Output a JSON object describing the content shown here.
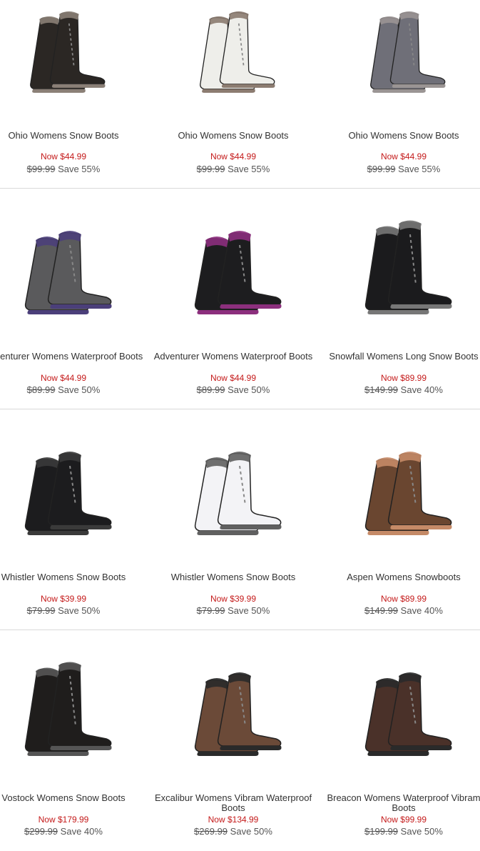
{
  "products": [
    {
      "name": "Ohio Womens Snow Boots",
      "now": "Now $44.99",
      "was": "$99.99",
      "save": "Save 55%",
      "icon": "snow-boot-black-icon",
      "color": "#2b2724",
      "trim": "#8a7f76"
    },
    {
      "name": "Ohio Womens Snow Boots",
      "now": "Now $44.99",
      "was": "$99.99",
      "save": "Save 55%",
      "icon": "snow-boot-white-icon",
      "color": "#eeeeea",
      "trim": "#8b7b70"
    },
    {
      "name": "Ohio Womens Snow Boots",
      "now": "Now $44.99",
      "was": "$99.99",
      "save": "Save 55%",
      "icon": "snow-boot-grey-icon",
      "color": "#6f6f78",
      "trim": "#9a9493"
    },
    {
      "name": "Adventurer Womens Waterproof Boots",
      "now": "Now $44.99",
      "was": "$89.99",
      "save": "Save 50%",
      "icon": "hiking-boot-grey-icon",
      "color": "#5a5a5c",
      "trim": "#4b3f7a"
    },
    {
      "name": "Adventurer Womens Waterproof Boots",
      "now": "Now $44.99",
      "was": "$89.99",
      "save": "Save 50%",
      "icon": "hiking-boot-black-icon",
      "color": "#1d1d1f",
      "trim": "#8c2f7d"
    },
    {
      "name": "Snowfall Womens Long Snow Boots",
      "now": "Now $89.99",
      "was": "$149.99",
      "save": "Save 40%",
      "icon": "long-snow-boot-icon",
      "color": "#1b1b1d",
      "trim": "#777"
    },
    {
      "name": "Whistler Womens Snow Boots",
      "now": "Now $39.99",
      "was": "$79.99",
      "save": "Save 50%",
      "icon": "snow-boot-black-icon",
      "color": "#1c1c1e",
      "trim": "#3a3a3a"
    },
    {
      "name": "Whistler Womens Snow Boots",
      "now": "Now $39.99",
      "was": "$79.99",
      "save": "Save 50%",
      "icon": "snow-boot-white-icon",
      "color": "#f3f3f6",
      "trim": "#606060"
    },
    {
      "name": "Aspen Womens Snowboots",
      "now": "Now $89.99",
      "was": "$149.99",
      "save": "Save 40%",
      "icon": "snow-boot-brown-icon",
      "color": "#6a4630",
      "trim": "#c58a67"
    },
    {
      "name": "Vostock Womens Snow Boots",
      "now": "Now $179.99",
      "was": "$299.99",
      "save": "Save 40%",
      "icon": "snow-boot-black-icon",
      "color": "#1f1d1c",
      "trim": "#555"
    },
    {
      "name": "Excalibur Womens Vibram Waterproof Boots",
      "now": "Now $134.99",
      "was": "$269.99",
      "save": "Save 50%",
      "icon": "hiking-boot-brown-icon",
      "color": "#6b4a38",
      "trim": "#2a2a2a"
    },
    {
      "name": "Breacon Womens Waterproof Vibram Boots",
      "now": "Now $99.99",
      "was": "$199.99",
      "save": "Save 50%",
      "icon": "hiking-boot-brown-icon",
      "color": "#4a3129",
      "trim": "#2a2a2a"
    }
  ]
}
